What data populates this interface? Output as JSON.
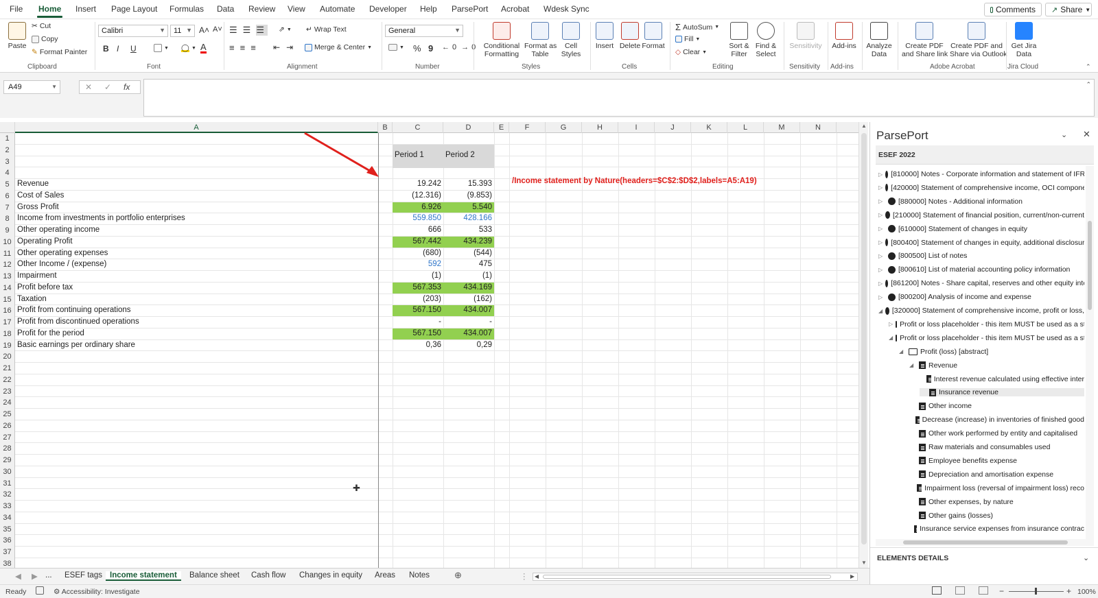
{
  "menu": {
    "file": "File",
    "tabs": [
      "Home",
      "Insert",
      "Page Layout",
      "Formulas",
      "Data",
      "Review",
      "View",
      "Automate",
      "Developer",
      "Help",
      "ParsePort",
      "Acrobat",
      "Wdesk Sync"
    ],
    "comments": "Comments",
    "share": "Share"
  },
  "ribbon": {
    "clipboard": {
      "paste": "Paste",
      "cut": "Cut",
      "copy": "Copy",
      "format_painter": "Format Painter",
      "label": "Clipboard"
    },
    "font": {
      "name": "Calibri",
      "size": "11",
      "label": "Font",
      "bold": "B",
      "italic": "I",
      "underline": "U",
      "grow": "A˄",
      "shrink": "A˅",
      "font_color": "A"
    },
    "alignment": {
      "wrap": "Wrap Text",
      "merge": "Merge & Center",
      "label": "Alignment"
    },
    "number": {
      "format": "General",
      "percent": "%",
      "comma": "9",
      "label": "Number"
    },
    "styles": {
      "conditional": "Conditional",
      "conditional2": "Formatting",
      "format_table": "Format as",
      "format_table2": "Table",
      "cell_styles": "Cell",
      "cell_styles2": "Styles",
      "label": "Styles"
    },
    "cells": {
      "insert": "Insert",
      "delete": "Delete",
      "format": "Format",
      "label": "Cells"
    },
    "editing": {
      "autosum": "AutoSum",
      "fill": "Fill",
      "clear": "Clear",
      "sort": "Sort &",
      "sort2": "Filter",
      "find": "Find &",
      "find2": "Select",
      "label": "Editing"
    },
    "sensitivity": {
      "btn": "Sensitivity",
      "label": "Sensitivity"
    },
    "addins": {
      "btn": "Add-ins",
      "label": "Add-ins"
    },
    "analyze": {
      "btn": "Analyze",
      "btn2": "Data"
    },
    "acrobat": {
      "create_pdf": "Create PDF",
      "create_pdf2": "and Share link",
      "create_outlook": "Create PDF and",
      "create_outlook2": "Share via Outlook",
      "label": "Adobe Acrobat"
    },
    "jira": {
      "btn": "Get Jira",
      "btn2": "Data",
      "label": "Jira Cloud"
    }
  },
  "formula_bar": {
    "name_box": "A49",
    "cancel": "✕",
    "enter": "✓",
    "fx": "fx",
    "value": ""
  },
  "grid": {
    "columns": [
      "A",
      "B",
      "C",
      "D",
      "E",
      "F",
      "G",
      "H",
      "I",
      "J",
      "K",
      "L",
      "M",
      "N"
    ],
    "header_row": {
      "c": "Period 1",
      "d": "Period 2"
    },
    "rows": [
      {
        "n": "5",
        "a": "Revenue",
        "c": "19.242",
        "d": "15.393",
        "style": ""
      },
      {
        "n": "6",
        "a": "Cost of Sales",
        "c": "(12.316)",
        "d": "(9.853)",
        "style": ""
      },
      {
        "n": "7",
        "a": "Gross Profit",
        "c": "6.926",
        "d": "5.540",
        "style": "green"
      },
      {
        "n": "8",
        "a": "Income from investments in portfolio enterprises",
        "c": "559.850",
        "d": "428.166",
        "style": "blue"
      },
      {
        "n": "9",
        "a": "Other operating income",
        "c": "666",
        "d": "533",
        "style": ""
      },
      {
        "n": "10",
        "a": "Operating Profit",
        "c": "567.442",
        "d": "434.239",
        "style": "green"
      },
      {
        "n": "11",
        "a": "Other operating expenses",
        "c": "(680)",
        "d": "(544)",
        "style": ""
      },
      {
        "n": "12",
        "a": "Other Income / (expense)",
        "c": "592",
        "d": "475",
        "style": "blue-c"
      },
      {
        "n": "13",
        "a": "Impairment",
        "c": "(1)",
        "d": "(1)",
        "style": ""
      },
      {
        "n": "14",
        "a": "Profit before tax",
        "c": "567.353",
        "d": "434.169",
        "style": "green"
      },
      {
        "n": "15",
        "a": "Taxation",
        "c": "(203)",
        "d": "(162)",
        "style": ""
      },
      {
        "n": "16",
        "a": "Profit from continuing operations",
        "c": "567.150",
        "d": "434.007",
        "style": "green"
      },
      {
        "n": "17",
        "a": "Profit from discontinued operations",
        "c": "-",
        "d": "-",
        "style": ""
      },
      {
        "n": "18",
        "a": "Profit for the period",
        "c": "567.150",
        "d": "434.007",
        "style": "green"
      },
      {
        "n": "19",
        "a": "Basic earnings per ordinary share",
        "c": "0,36",
        "d": "0,29",
        "style": ""
      }
    ],
    "annotation": "/Income statement by Nature(headers=$C$2:$D$2,labels=A5:A19)",
    "row_numbers": [
      "1",
      "2",
      "3",
      "4",
      "5",
      "6",
      "7",
      "8",
      "9",
      "10",
      "11",
      "12",
      "13",
      "14",
      "15",
      "16",
      "17",
      "18",
      "19",
      "20",
      "21",
      "22",
      "23",
      "24",
      "25",
      "26",
      "27",
      "28",
      "29",
      "30",
      "31",
      "32",
      "33",
      "34",
      "35",
      "36",
      "37",
      "38"
    ]
  },
  "parseport": {
    "title": "ParsePort",
    "taxonomy": "ESEF 2022",
    "items": [
      {
        "t": "[810000] Notes - Corporate information and statement of IFR",
        "icon": "gear",
        "lvl": 0,
        "exp": "▷"
      },
      {
        "t": "[420000] Statement of comprehensive income, OCI compone",
        "icon": "gear",
        "lvl": 0,
        "exp": "▷"
      },
      {
        "t": "[880000] Notes - Additional information",
        "icon": "gear",
        "lvl": 0,
        "exp": "▷"
      },
      {
        "t": "[210000] Statement of financial position, current/non-current",
        "icon": "gear",
        "lvl": 0,
        "exp": "▷"
      },
      {
        "t": "[610000] Statement of changes in equity",
        "icon": "gear",
        "lvl": 0,
        "exp": "▷"
      },
      {
        "t": "[800400] Statement of changes in equity, additional disclosur",
        "icon": "gear",
        "lvl": 0,
        "exp": "▷"
      },
      {
        "t": "[800500] List of notes",
        "icon": "gear",
        "lvl": 0,
        "exp": "▷"
      },
      {
        "t": "[800610] List of material accounting policy information",
        "icon": "gear",
        "lvl": 0,
        "exp": "▷"
      },
      {
        "t": "[861200] Notes - Share capital, reserves and other equity inte",
        "icon": "gear",
        "lvl": 0,
        "exp": "▷"
      },
      {
        "t": "[800200] Analysis of income and expense",
        "icon": "gear",
        "lvl": 0,
        "exp": "▷"
      },
      {
        "t": "[320000] Statement of comprehensive income, profit or loss,",
        "icon": "gear",
        "lvl": 0,
        "exp": "◢"
      },
      {
        "t": "Profit or loss placeholder - this item MUST be used as a st",
        "icon": "folder",
        "lvl": 1,
        "exp": "▷"
      },
      {
        "t": "Profit or loss placeholder - this item MUST be used as a st",
        "icon": "folder",
        "lvl": 1,
        "exp": "◢"
      },
      {
        "t": "Profit (loss) [abstract]",
        "icon": "folder",
        "lvl": 2,
        "exp": "◢"
      },
      {
        "t": "Revenue",
        "icon": "doc",
        "lvl": 3,
        "exp": "◢"
      },
      {
        "t": "Interest revenue calculated using effective inter",
        "icon": "doc",
        "lvl": 4,
        "exp": ""
      },
      {
        "t": "Insurance revenue",
        "icon": "doc",
        "lvl": 4,
        "exp": ""
      },
      {
        "t": "Other income",
        "icon": "doc",
        "lvl": 3,
        "exp": ""
      },
      {
        "t": "Decrease (increase) in inventories of finished good",
        "icon": "doc",
        "lvl": 3,
        "exp": ""
      },
      {
        "t": "Other work performed by entity and capitalised",
        "icon": "doc",
        "lvl": 3,
        "exp": ""
      },
      {
        "t": "Raw materials and consumables used",
        "icon": "doc",
        "lvl": 3,
        "exp": ""
      },
      {
        "t": "Employee benefits expense",
        "icon": "doc",
        "lvl": 3,
        "exp": ""
      },
      {
        "t": "Depreciation and amortisation expense",
        "icon": "doc",
        "lvl": 3,
        "exp": ""
      },
      {
        "t": "Impairment loss (reversal of impairment loss) reco",
        "icon": "doc",
        "lvl": 3,
        "exp": ""
      },
      {
        "t": "Other expenses, by nature",
        "icon": "doc",
        "lvl": 3,
        "exp": ""
      },
      {
        "t": "Other gains (losses)",
        "icon": "doc",
        "lvl": 3,
        "exp": ""
      },
      {
        "t": "Insurance service expenses from insurance contrac",
        "icon": "doc",
        "lvl": 3,
        "exp": ""
      }
    ],
    "details": "ELEMENTS DETAILS"
  },
  "sheet_tabs": [
    "ESEF tags",
    "Income statement",
    "Balance sheet",
    "Cash flow",
    "Changes in equity",
    "Areas",
    "Notes"
  ],
  "sheet_tabs_more": "...",
  "status": {
    "ready": "Ready",
    "accessibility": "Accessibility: Investigate",
    "zoom": "100%"
  },
  "colors": {
    "green": "#92d050",
    "accent": "#185c37",
    "blue_text": "#2e75c9",
    "annotation_red": "#e0201c"
  }
}
